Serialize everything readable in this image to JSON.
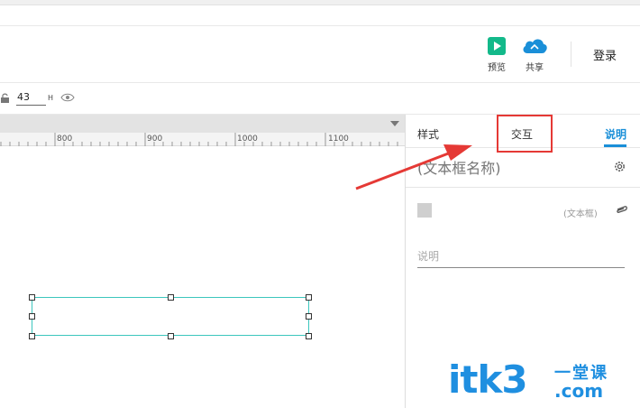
{
  "toolbar": {
    "preview_label": "预览",
    "share_label": "共享",
    "login_label": "登录",
    "preview_icon": "play-icon",
    "share_icon": "cloud-icon",
    "preview_color": "#13b98a",
    "share_color": "#1a8fd8"
  },
  "properties": {
    "height_value": "43",
    "height_label": "H"
  },
  "ruler": {
    "labels": [
      "800",
      "900",
      "1000",
      "1100"
    ]
  },
  "panel": {
    "tabs": {
      "style": "样式",
      "interact": "交互",
      "note": "说明"
    },
    "name_placeholder": "(文本框名称)",
    "widget_type": "(文本框)",
    "note_placeholder": "说明",
    "active_tab_color": "#1a8fd8"
  },
  "annotation": {
    "highlight_color": "#e53935",
    "highlighted_tab": "交互"
  },
  "watermark": {
    "brand": "itk3",
    "cn": "一堂课",
    "domain": ".com"
  }
}
